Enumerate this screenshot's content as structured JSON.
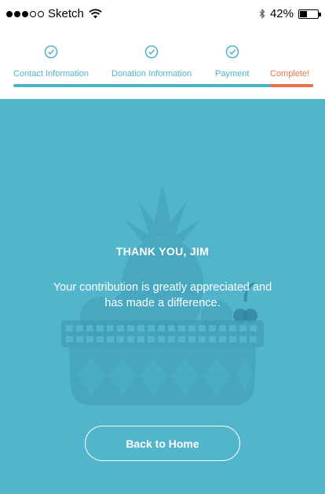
{
  "status_bar": {
    "carrier": "Sketch",
    "battery_text": "42%",
    "battery_level": 0.42,
    "signal_bars_filled": 3,
    "signal_bars_total": 5
  },
  "stepper": {
    "steps": [
      {
        "label": "Contact Information",
        "state": "done"
      },
      {
        "label": "Donation Information",
        "state": "done"
      },
      {
        "label": "Payment",
        "state": "done"
      },
      {
        "label": "Complete!",
        "state": "current"
      }
    ],
    "colors": {
      "done": "#4db3c8",
      "current": "#ec7149"
    }
  },
  "hero": {
    "background_color": "#52b5cb",
    "title": "THANK YOU, JIM",
    "message": "Your contribution is greatly appreciated and has made a difference.",
    "home_button_label": "Back to Home",
    "illustration": "fruit-basket-icon"
  }
}
